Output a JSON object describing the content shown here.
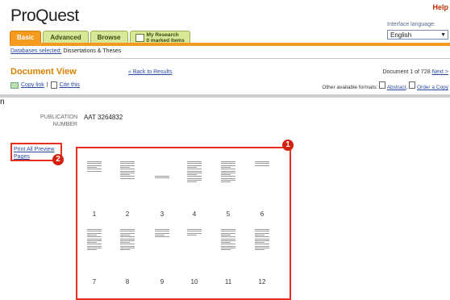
{
  "logo": "ProQuest",
  "help": "Help",
  "language": {
    "label": "Interface language:",
    "value": "English"
  },
  "tabs": [
    {
      "label": "Basic",
      "active": true
    },
    {
      "label": "Advanced",
      "active": false
    },
    {
      "label": "Browse",
      "active": false
    },
    {
      "line1": "My Research",
      "line2": "0 marked items",
      "active": false
    }
  ],
  "breadcrumb": {
    "link": "Databases selected:",
    "text": "Dissertations & Theses"
  },
  "doc": {
    "title": "Document View",
    "back": "« Back to Results",
    "copy_link": "Copy link",
    "cite": "Cite this",
    "position": "Document 1 of 728",
    "next": "Next >",
    "formats_label": "Other available formats:",
    "abstract": "Abstract",
    "order": "Order a Copy"
  },
  "annotation_n": "n",
  "publication": {
    "label": "PUBLICATION NUMBER",
    "value": "AAT 3264832"
  },
  "print_link": "Print All Preview Pages",
  "badges": {
    "one": "1",
    "two": "2"
  },
  "pages": [
    "1",
    "2",
    "3",
    "4",
    "5",
    "6",
    "7",
    "8",
    "9",
    "10",
    "11",
    "12"
  ],
  "colors": {
    "accent": "#f39a1f",
    "highlight": "#e53020",
    "link": "#2a4aa0"
  }
}
